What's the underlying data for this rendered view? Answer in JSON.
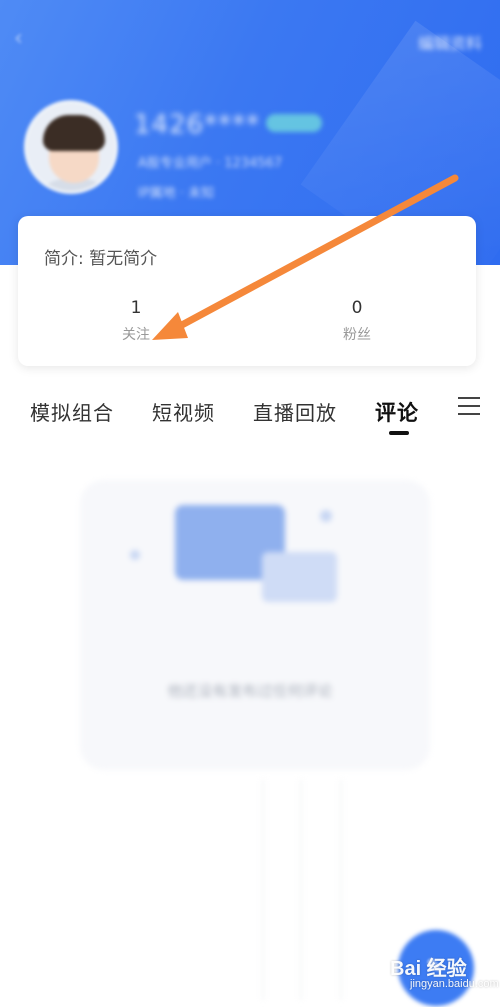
{
  "header": {
    "back_icon": "back-arrow-icon",
    "edit_label": "编辑资料",
    "profile": {
      "blurred_name": "1426****",
      "blurred_line1": "A股专业用户 · 1234567",
      "blurred_line2": "IP属地 · 未知"
    }
  },
  "card": {
    "intro": "简介: 暂无简介",
    "stats": [
      {
        "value": "1",
        "label": "关注"
      },
      {
        "value": "0",
        "label": "粉丝"
      }
    ]
  },
  "tabs": {
    "items": [
      {
        "label": "模拟组合"
      },
      {
        "label": "短视频"
      },
      {
        "label": "直播回放"
      },
      {
        "label": "评论"
      }
    ],
    "active_index": 3,
    "menu_icon": "hamburger-menu-icon"
  },
  "empty_state": {
    "message": "他还没有发布过任何评论"
  },
  "fab": {
    "icon": "edit-pencil-icon"
  },
  "watermark": {
    "main": "Bai 经验",
    "sub": "jingyan.baidu.com"
  },
  "colors": {
    "header_blue": "#3b78f2",
    "annotation_arrow": "#f5883a"
  }
}
